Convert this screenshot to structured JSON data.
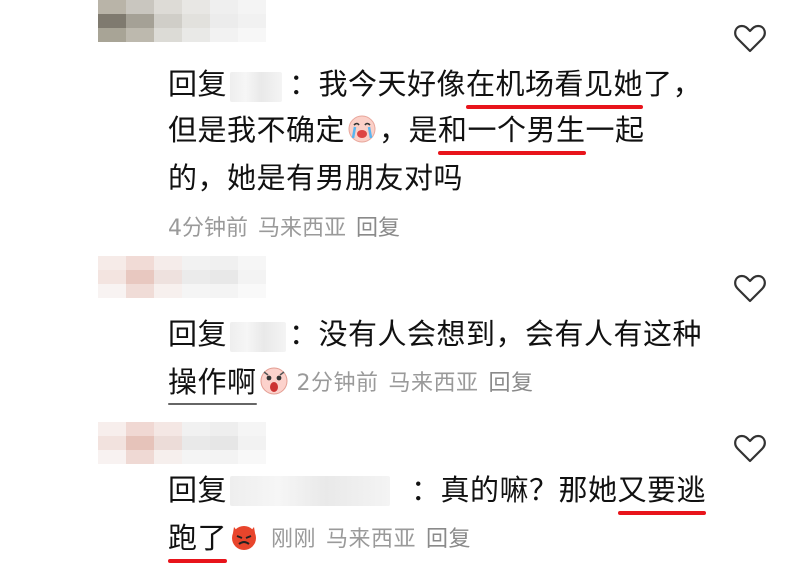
{
  "comments": [
    {
      "reply_label": "回复",
      "colon": "：",
      "text_lines": [
        [
          "我今天好像",
          "在机场看见她",
          "了，"
        ],
        [
          "但是我不确定",
          "emoji",
          "，是",
          "和一个男生",
          "一起"
        ],
        [
          "的，她是有男朋友对吗"
        ]
      ],
      "meta": {
        "time": "4分钟前",
        "location": "马来西亚",
        "reply": "回复"
      },
      "emoji": "crying-face"
    },
    {
      "reply_label": "回复",
      "colon": "：",
      "text_lines": [
        [
          "没有人会想到，会有人有这种"
        ],
        [
          "操作啊"
        ]
      ],
      "meta": {
        "time": "2分钟前",
        "location": "马来西亚",
        "reply": "回复"
      },
      "emoji": "screaming-face"
    },
    {
      "reply_label": "回复",
      "colon": "：",
      "text_lines": [
        [
          "真的嘛？那她",
          "又要逃"
        ],
        [
          "跑了"
        ]
      ],
      "meta": {
        "time": "刚刚",
        "location": "马来西亚",
        "reply": "回复"
      },
      "emoji": "devil-face"
    }
  ],
  "colors": {
    "underline": "#e8141b",
    "meta_text": "#9a9a9a",
    "body_text": "#111111"
  },
  "icons": [
    "heart-outline-icon",
    "crying-face-emoji",
    "screaming-face-emoji",
    "devil-face-emoji"
  ]
}
